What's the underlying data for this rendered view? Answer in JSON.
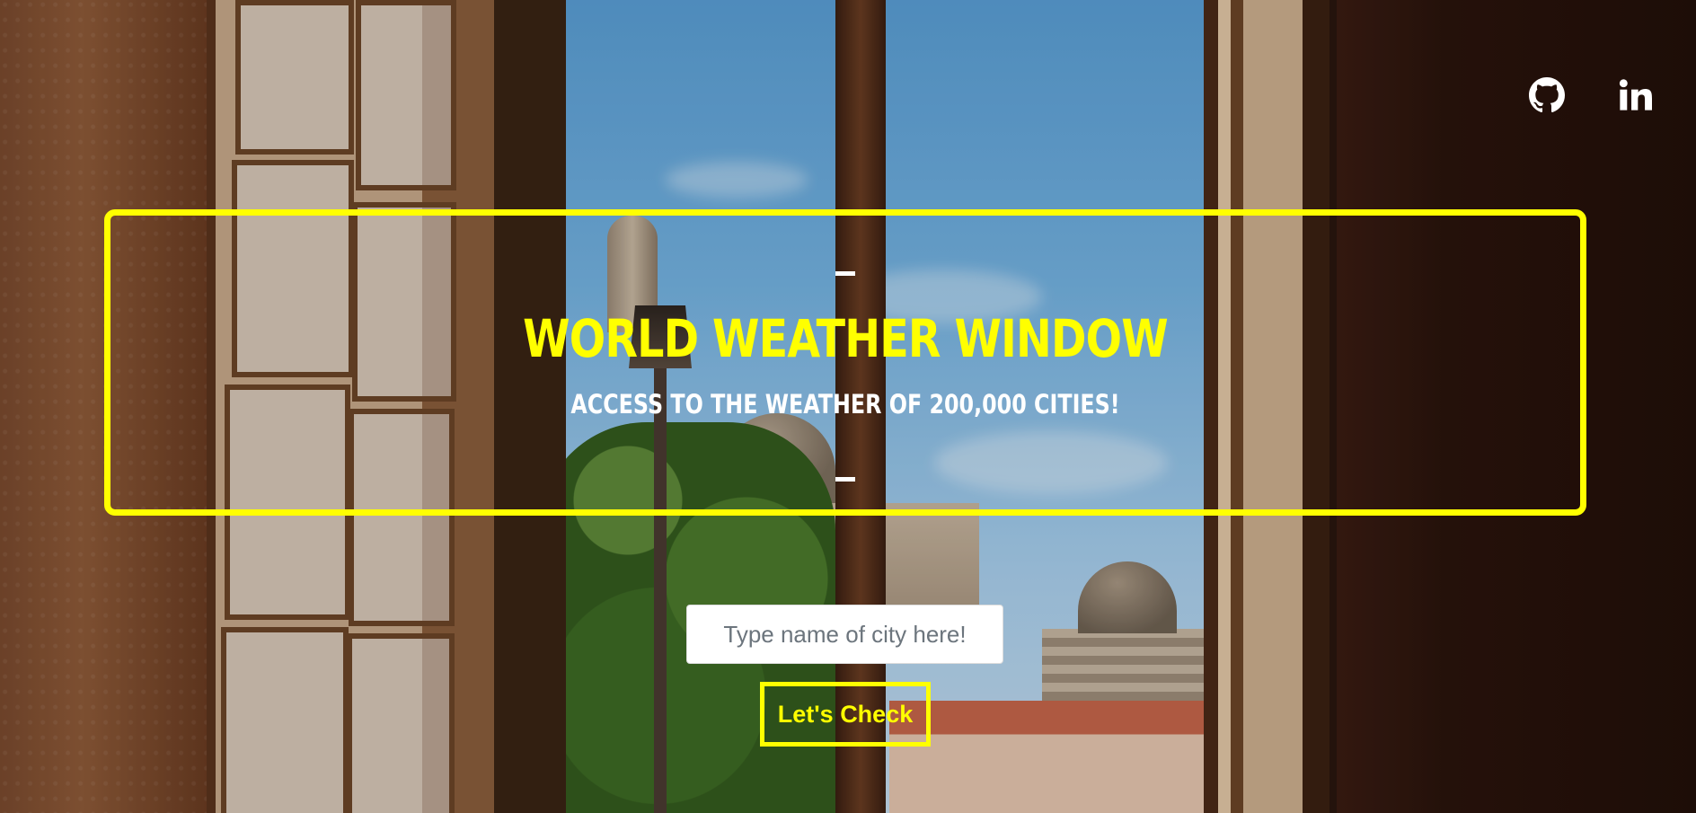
{
  "social": {
    "github_icon": "github-icon",
    "linkedin_icon": "linkedin-icon",
    "linkedin_label": "in"
  },
  "hero": {
    "title": "World Weather Window",
    "subtitle": "Access to the weather of 200,000 cities!",
    "accent_color": "#ffff00"
  },
  "search": {
    "placeholder": "Type name of city here!",
    "value": "",
    "button_label": "Let's Check"
  }
}
